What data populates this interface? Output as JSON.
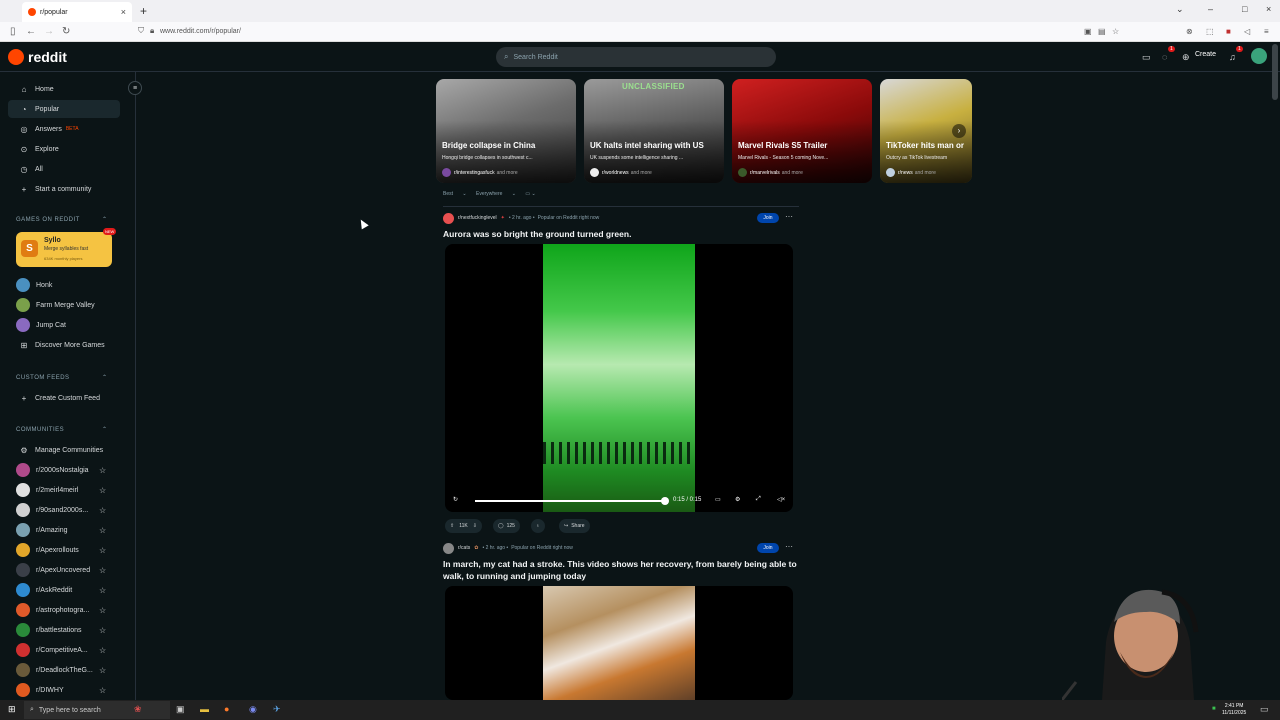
{
  "browser": {
    "tab_title": "r/popular",
    "url": "www.reddit.com/r/popular/"
  },
  "header": {
    "wordmark": "reddit",
    "search_placeholder": "Search Reddit",
    "create_label": "Create",
    "chat_badge": "1",
    "notif_badge": "1"
  },
  "sidebar": {
    "nav": [
      {
        "label": "Home",
        "icon": "home-icon"
      },
      {
        "label": "Popular",
        "icon": "popular-icon"
      },
      {
        "label": "Answers",
        "icon": "answers-icon",
        "badge": "BETA"
      },
      {
        "label": "Explore",
        "icon": "explore-icon"
      },
      {
        "label": "All",
        "icon": "all-icon"
      },
      {
        "label": "Start a community",
        "icon": "plus-icon"
      }
    ],
    "games_title": "GAMES ON REDDIT",
    "featured_game": {
      "name": "Syllo",
      "desc": "Merge syllables fast",
      "players": "634K monthly players",
      "badge": "NEW"
    },
    "games": [
      "Honk",
      "Farm Merge Valley",
      "Jump Cat",
      "Discover More Games"
    ],
    "custom_feeds_title": "CUSTOM FEEDS",
    "create_custom_feed": "Create Custom Feed",
    "communities_title": "COMMUNITIES",
    "manage_communities": "Manage Communities",
    "communities": [
      {
        "name": "r/2000sNostalgia",
        "color": "#b04a8a"
      },
      {
        "name": "r/2meirl4meirl",
        "color": "#e0e0e0"
      },
      {
        "name": "r/90sand2000s...",
        "color": "#d0d0d0"
      },
      {
        "name": "r/Amazing",
        "color": "#7aa0b0"
      },
      {
        "name": "r/Apexrollouts",
        "color": "#e2a62a"
      },
      {
        "name": "r/ApexUncovered",
        "color": "#3a3f48"
      },
      {
        "name": "r/AskReddit",
        "color": "#2e8ad0"
      },
      {
        "name": "r/astrophotogra...",
        "color": "#e05a2a"
      },
      {
        "name": "r/battlestations",
        "color": "#2a8a3a"
      },
      {
        "name": "r/CompetitiveA...",
        "color": "#d03030"
      },
      {
        "name": "r/DeadlockTheG...",
        "color": "#6a5a3a"
      },
      {
        "name": "r/DIWHY",
        "color": "#e05a20"
      }
    ]
  },
  "trending": [
    {
      "title": "Bridge collapse in China",
      "desc": "Hongqi bridge collapses in southwest c...",
      "sub": "r/interestingasfuck",
      "more": "and more"
    },
    {
      "title": "UK halts intel sharing with US",
      "desc": "UK suspends some intelligence sharing ...",
      "sub": "r/worldnews",
      "more": "and more",
      "overlay": "UNCLASSIFIED"
    },
    {
      "title": "Marvel Rivals S5 Trailer",
      "desc": "Marvel Rivals - Season 5 coming Nove...",
      "sub": "r/marvelrivals",
      "more": "and more"
    },
    {
      "title": "TikToker hits man or",
      "desc": "Outcry as TikTok livestream",
      "sub": "r/news",
      "more": "and more"
    }
  ],
  "filters": {
    "sort": "Best",
    "location": "Everywhere"
  },
  "posts": [
    {
      "sub": "r/nextfuckinglevel",
      "time": "• 2 hr. ago •",
      "popular": "Popular on Reddit right now",
      "join": "Join",
      "title": "Aurora was so bright the ground turned green.",
      "time_display": "0:15 / 0:15",
      "votes": "11K",
      "comments": "125",
      "share": "Share"
    },
    {
      "sub": "r/cats",
      "time": "• 2 hr. ago •",
      "popular": "Popular on Reddit right now",
      "join": "Join",
      "title": "In march, my cat had a stroke. This video shows her recovery, from barely being able to walk, to running and jumping today"
    }
  ],
  "taskbar": {
    "search_placeholder": "Type here to search",
    "time": "2:41 PM",
    "date": "11/11/2025"
  }
}
